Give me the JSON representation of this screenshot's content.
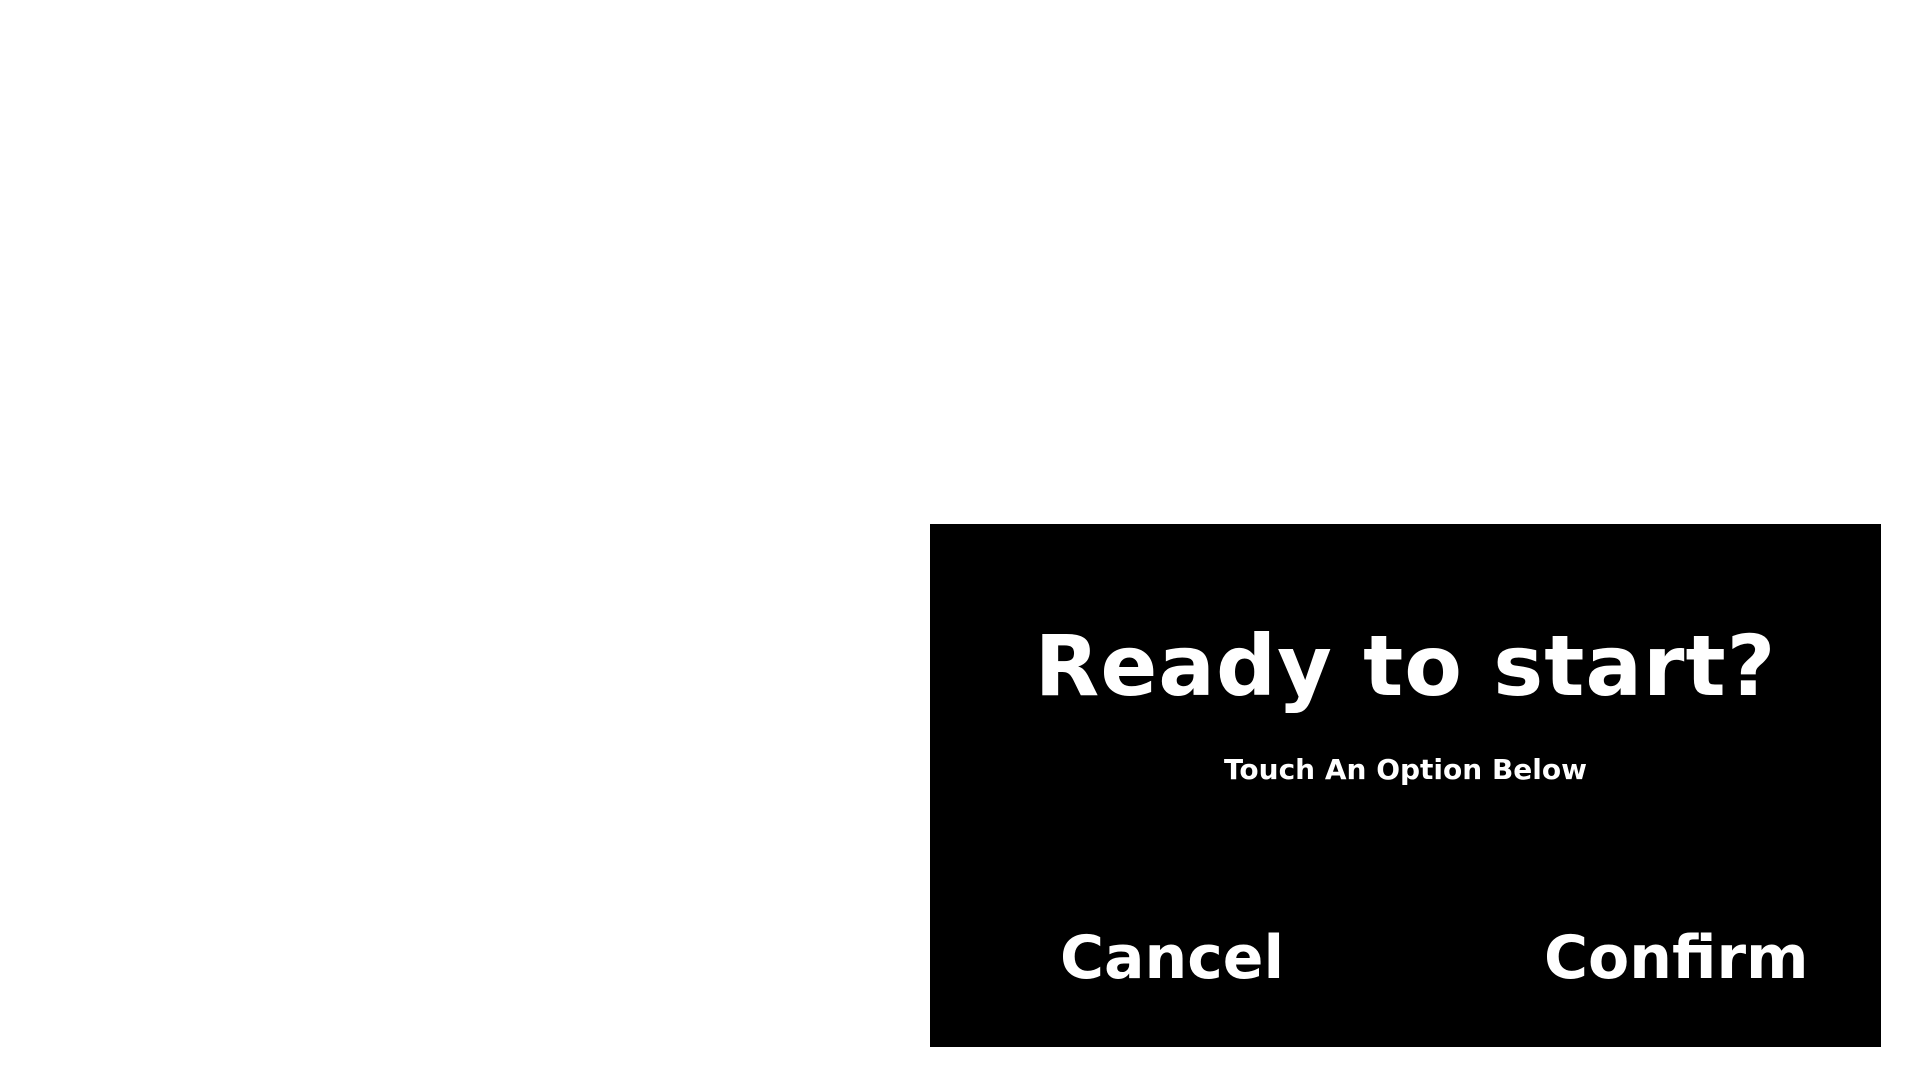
{
  "dialog": {
    "title": "Ready to start?",
    "subtitle": "Touch An Option Below",
    "cancel_label": "Cancel",
    "confirm_label": "Confirm"
  },
  "colors": {
    "page_background": "#ffffff",
    "dialog_background": "#000000",
    "text": "#ffffff"
  }
}
